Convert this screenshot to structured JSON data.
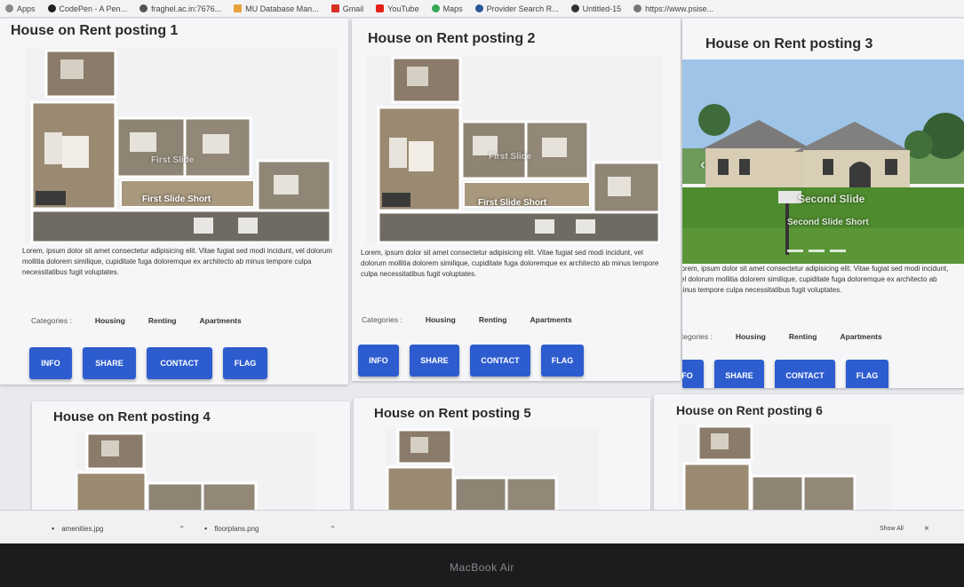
{
  "bookmarks": [
    {
      "label": "Apps",
      "color": "#8a8a8a"
    },
    {
      "label": "CodePen - A Pen...",
      "color": "#222222"
    },
    {
      "label": "fraghel.ac.in:7676...",
      "color": "#555555"
    },
    {
      "label": "MU Database Man...",
      "color": "#e8a23c"
    },
    {
      "label": "Gmail",
      "color": "#d93025"
    },
    {
      "label": "YouTube",
      "color": "#e62117"
    },
    {
      "label": "Maps",
      "color": "#34a853"
    },
    {
      "label": "Provider Search R...",
      "color": "#2b5797"
    },
    {
      "label": "Untitled-15",
      "color": "#333333"
    },
    {
      "label": "https://www.psise...",
      "color": "#777777"
    }
  ],
  "listings": [
    {
      "title": "House on Rent posting 1",
      "slide_title": "First Slide",
      "slide_caption": "First Slide Short"
    },
    {
      "title": "House on Rent posting 2",
      "slide_title": "First Slide",
      "slide_caption": "First Slide Short"
    },
    {
      "title": "House on Rent posting 3",
      "slide_title": "Second Slide",
      "slide_caption": "Second Slide Short"
    },
    {
      "title": "House on Rent posting 4"
    },
    {
      "title": "House on Rent posting 5"
    },
    {
      "title": "House on Rent posting 6"
    }
  ],
  "description": "Lorem, ipsum dolor sit amet consectetur adipisicing elit. Vitae fugiat sed modi incidunt, vel dolorum mollitia dolorem similique, cupiditate fuga doloremque ex architecto ab minus tempore culpa necessitatibus fugit voluptates.",
  "categories": {
    "label": "Categories :",
    "items": [
      "Housing",
      "Renting",
      "Apartments"
    ]
  },
  "buttons": {
    "info": "INFO",
    "share": "SHARE",
    "contact": "CONTACT",
    "flag": "FLAG"
  },
  "downloads": {
    "files": [
      "amenities.jpg",
      "floorplans.png"
    ],
    "show_all": "Show All"
  },
  "device_label": "MacBook Air",
  "colors": {
    "button": "#2d5ccf",
    "sky": "#9ec4e8",
    "lawn": "#4e8a2e"
  }
}
